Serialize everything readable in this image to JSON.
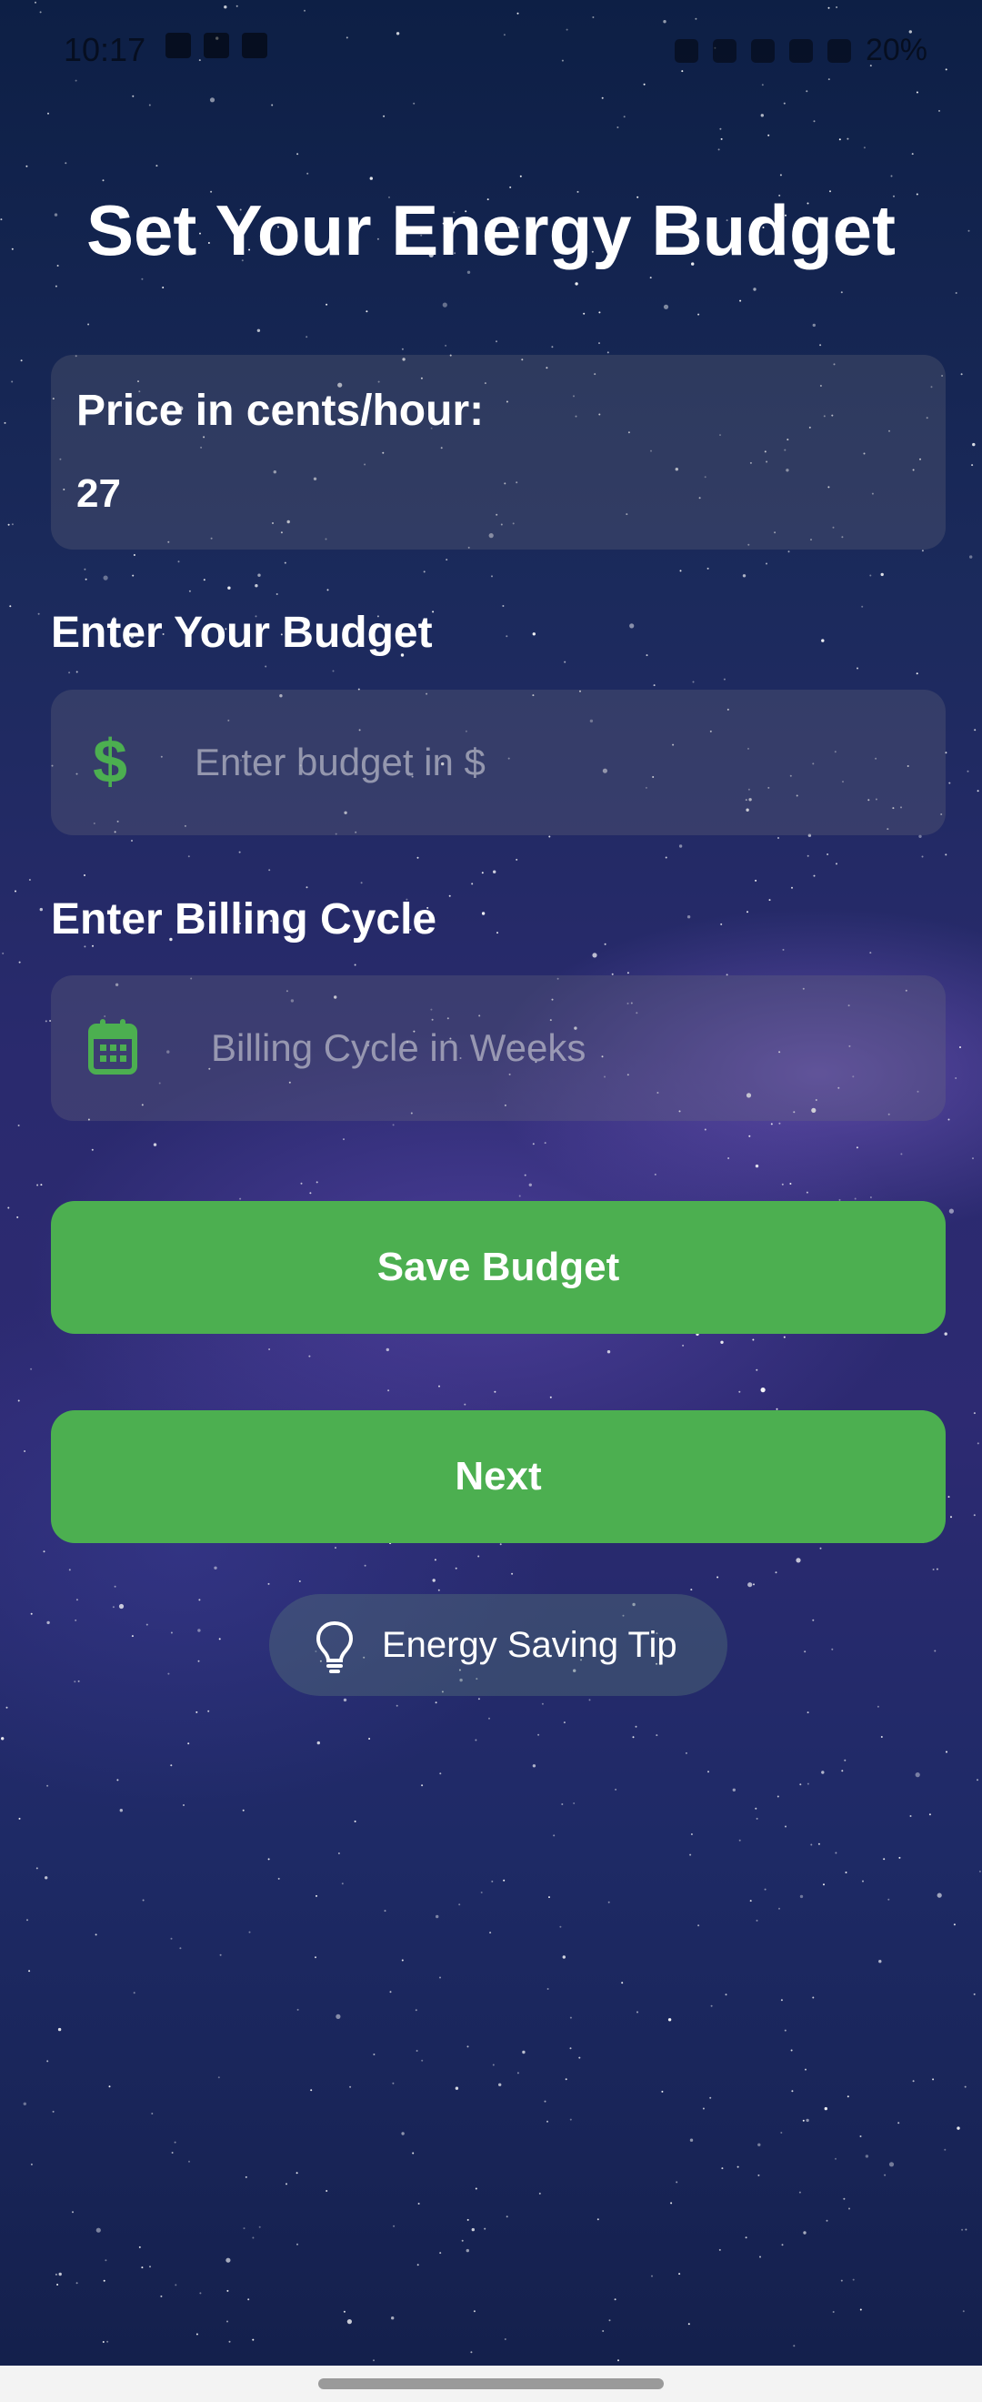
{
  "status_bar": {
    "time": "10:17",
    "battery": "20%"
  },
  "page": {
    "title": "Set Your Energy Budget"
  },
  "price_card": {
    "label": "Price in cents/hour:",
    "value": "27"
  },
  "budget": {
    "label": "Enter Your Budget",
    "placeholder": "Enter budget in $",
    "icon": "dollar-icon"
  },
  "billing": {
    "label": "Enter Billing Cycle",
    "placeholder": "Billing Cycle in Weeks",
    "icon": "calendar-icon"
  },
  "buttons": {
    "save_label": "Save Budget",
    "next_label": "Next"
  },
  "tip": {
    "label": "Energy Saving Tip",
    "icon": "lightbulb-icon"
  },
  "colors": {
    "accent": "#4caf50",
    "text": "#ffffff"
  }
}
